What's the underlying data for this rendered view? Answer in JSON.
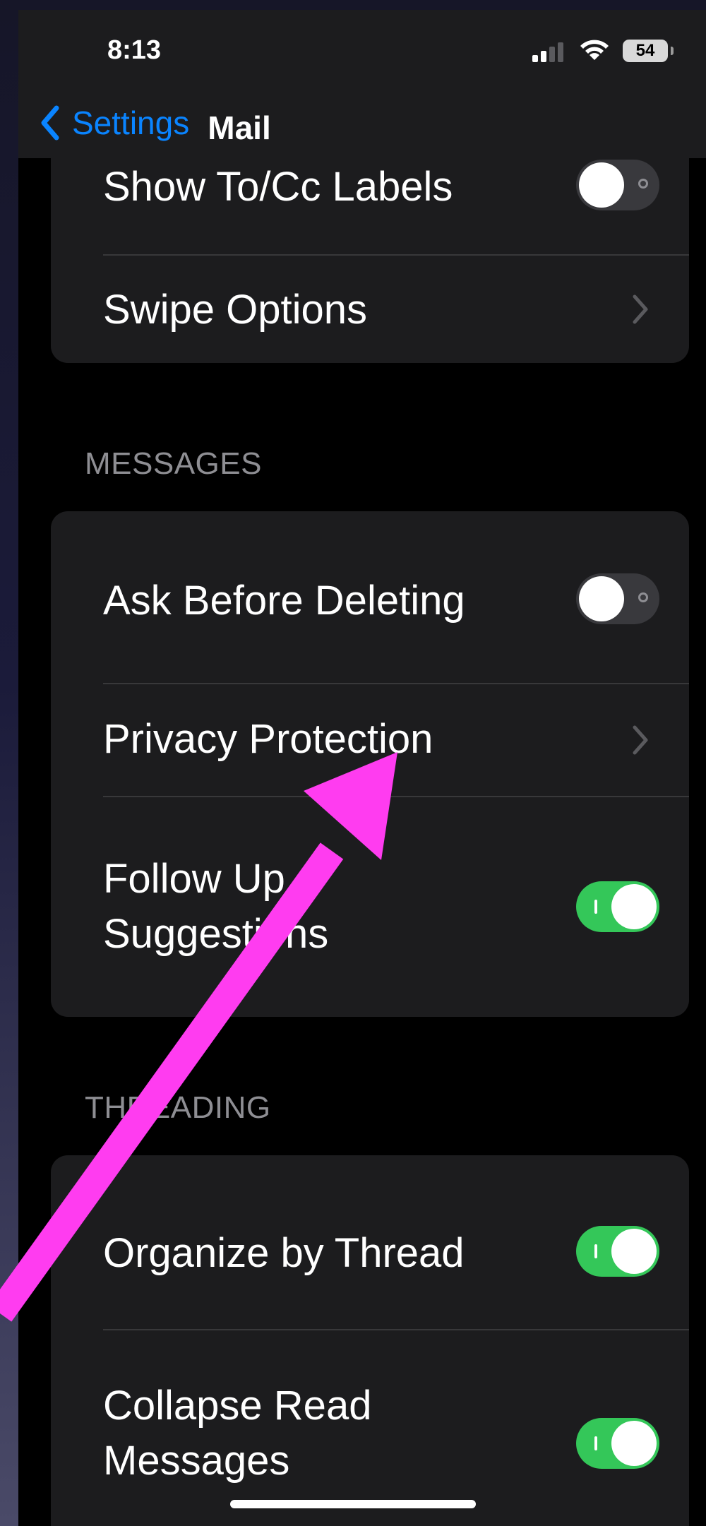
{
  "status_bar": {
    "time": "8:13",
    "battery": "54"
  },
  "nav": {
    "back_label": "Settings",
    "title": "Mail"
  },
  "group_top": {
    "rows": [
      {
        "label": "Show To/Cc Labels",
        "toggle": false
      },
      {
        "label": "Swipe Options"
      }
    ]
  },
  "messages": {
    "header": "MESSAGES",
    "rows": [
      {
        "label": "Ask Before Deleting",
        "toggle": false
      },
      {
        "label": "Privacy Protection"
      },
      {
        "label_line1": "Follow Up",
        "label_line2": "Suggestions",
        "toggle": true
      }
    ]
  },
  "threading": {
    "header": "THREADING",
    "rows": [
      {
        "label": "Organize by Thread",
        "toggle": true
      },
      {
        "label_line1": "Collapse Read",
        "label_line2": "Messages",
        "toggle": true
      }
    ]
  },
  "colors": {
    "accent": "#0a84ff",
    "toggle_on": "#34c759",
    "annotation_arrow": "#ff3cf0"
  }
}
